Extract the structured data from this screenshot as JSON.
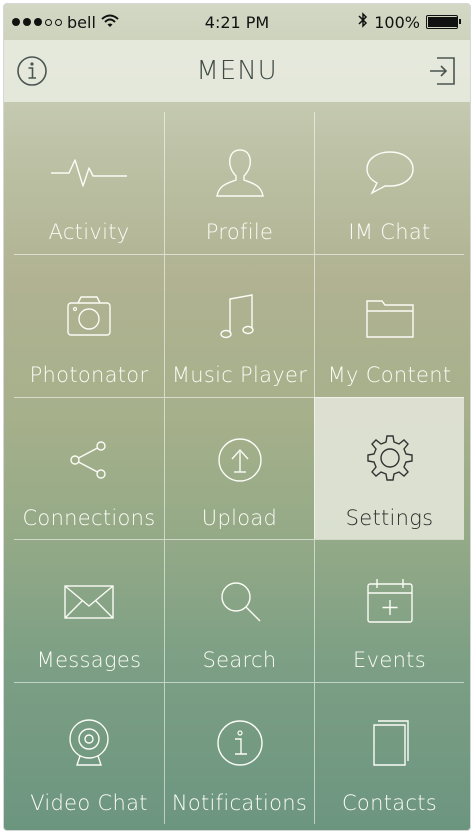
{
  "status_bar": {
    "carrier": "bell",
    "time": "4:21 PM",
    "battery": "100%",
    "battery_fraction": 1.0
  },
  "header": {
    "title": "MENU",
    "info_icon": "info-icon",
    "logout_icon": "sign-out-icon"
  },
  "menu": {
    "selected_index": 8,
    "items": [
      {
        "label": "Activity",
        "icon": "activity-pulse-icon"
      },
      {
        "label": "Profile",
        "icon": "user-icon"
      },
      {
        "label": "IM Chat",
        "icon": "chat-bubble-icon"
      },
      {
        "label": "Photonator",
        "icon": "camera-icon"
      },
      {
        "label": "Music Player",
        "icon": "music-note-icon"
      },
      {
        "label": "My Content",
        "icon": "folder-icon"
      },
      {
        "label": "Connections",
        "icon": "share-icon"
      },
      {
        "label": "Upload",
        "icon": "upload-icon"
      },
      {
        "label": "Settings",
        "icon": "gear-icon"
      },
      {
        "label": "Messages",
        "icon": "envelope-icon"
      },
      {
        "label": "Search",
        "icon": "search-icon"
      },
      {
        "label": "Events",
        "icon": "calendar-add-icon"
      },
      {
        "label": "Video Chat",
        "icon": "webcam-icon"
      },
      {
        "label": "Notifications",
        "icon": "info-circle-icon"
      },
      {
        "label": "Contacts",
        "icon": "contacts-book-icon"
      }
    ]
  },
  "colors": {
    "tile_text": "#fbfcf6",
    "selected_tile": "#e6e9dd",
    "header_bg": "#e8ece0"
  }
}
